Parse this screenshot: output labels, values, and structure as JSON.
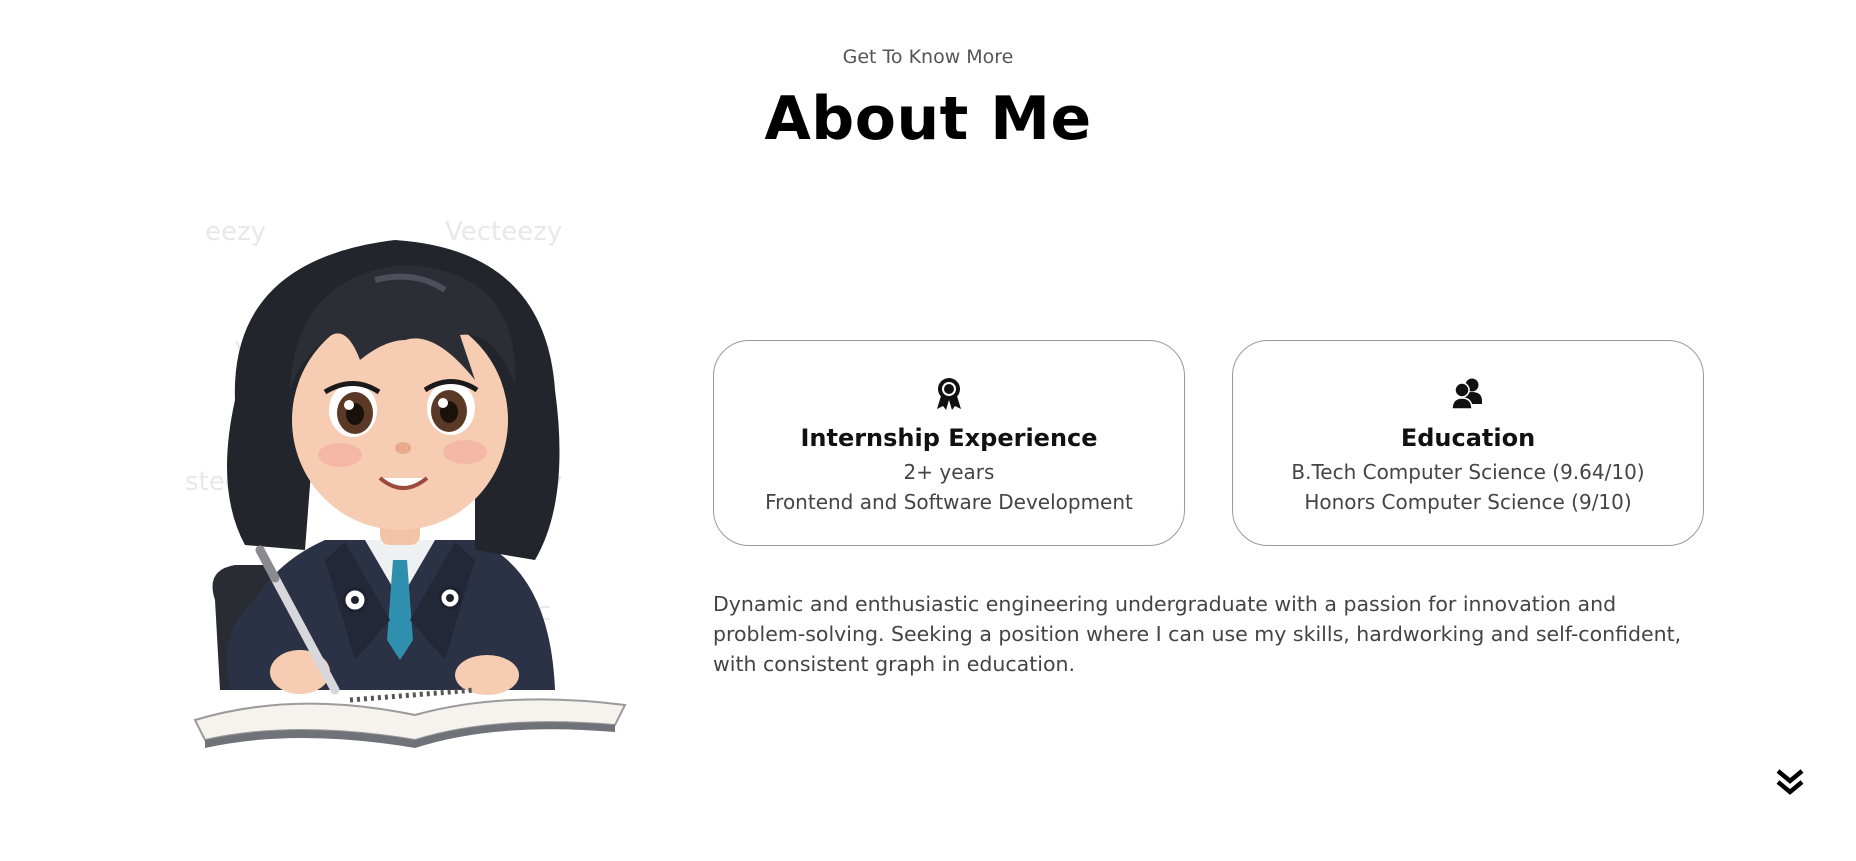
{
  "header": {
    "subtitle": "Get To Know More",
    "title": "About Me"
  },
  "profile_image": {
    "alt": "cartoon girl writing in notebook",
    "watermark": "Vecteezy"
  },
  "cards": [
    {
      "icon": "award-icon",
      "title": "Internship Experience",
      "lines": [
        "2+ years",
        "Frontend and Software Development"
      ]
    },
    {
      "icon": "users-icon",
      "title": "Education",
      "lines": [
        "B.Tech Computer Science (9.64/10)",
        "Honors Computer Science (9/10)"
      ]
    }
  ],
  "description": "Dynamic and enthusiastic engineering undergraduate with a passion for innovation and problem-solving. Seeking a position where I can use my skills, hardworking and self-confident, with consistent graph in education.",
  "scroll_icon": "double-chevron-down-icon",
  "colors": {
    "background": "#ffffff",
    "card_border": "#9a9a9a",
    "text_primary": "#000000",
    "text_secondary": "#444444"
  }
}
